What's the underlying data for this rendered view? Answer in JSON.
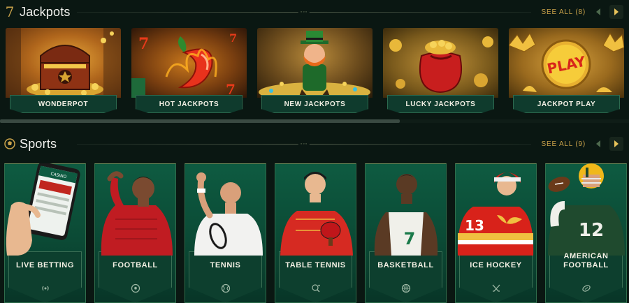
{
  "jackpots": {
    "icon": "seven-icon",
    "icon_glyph": "7",
    "title": "Jackpots",
    "see_all": "SEE ALL (8)",
    "cards": [
      {
        "label": "WONDERPOT"
      },
      {
        "label": "HOT JACKPOTS"
      },
      {
        "label": "NEW JACKPOTS"
      },
      {
        "label": "LUCKY JACKPOTS"
      },
      {
        "label": "JACKPOT PLAY",
        "art_text": "PLAY"
      }
    ]
  },
  "sports": {
    "icon": "soccer-ball-icon",
    "title": "Sports",
    "see_all": "SEE ALL (9)",
    "cards": [
      {
        "label": "LIVE BETTING",
        "icon": "live-signal-icon",
        "phone_text": "CASINO"
      },
      {
        "label": "FOOTBALL",
        "icon": "soccer-ball-icon"
      },
      {
        "label": "TENNIS",
        "icon": "tennis-ball-icon"
      },
      {
        "label": "TABLE TENNIS",
        "icon": "table-tennis-icon"
      },
      {
        "label": "BASKETBALL",
        "icon": "basketball-icon",
        "jersey_number": "7"
      },
      {
        "label": "ICE HOCKEY",
        "icon": "hockey-sticks-icon",
        "jersey_number": "13"
      },
      {
        "label": "AMERICAN FOOTBALL",
        "label_line1": "AMERICAN",
        "label_line2": "FOOTBALL",
        "icon": "american-football-icon",
        "jersey_number": "12"
      }
    ]
  },
  "colors": {
    "background": "#0a1712",
    "accent_gold": "#c9a24a",
    "card_green": "#0e5b41",
    "plaque_green": "#0f3b2d"
  }
}
